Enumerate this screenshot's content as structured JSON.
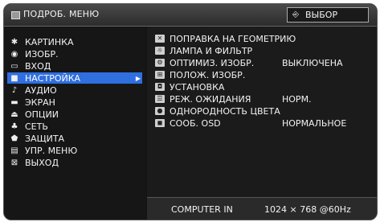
{
  "header": {
    "title": "ПОДРОБ. МЕНЮ",
    "select_label": "ВЫБОР",
    "select_icon": "ENTER-select-icon"
  },
  "menu": {
    "items": [
      {
        "label": "КАРТИНКА",
        "icon": "sun-icon"
      },
      {
        "label": "ИЗОБР.",
        "icon": "image-icon"
      },
      {
        "label": "ВХОД",
        "icon": "input-icon"
      },
      {
        "label": "НАСТРОЙКА",
        "icon": "setup-icon",
        "active": true
      },
      {
        "label": "АУДИО",
        "icon": "note-icon"
      },
      {
        "label": "ЭКРАН",
        "icon": "screen-icon"
      },
      {
        "label": "ОПЦИИ",
        "icon": "options-icon"
      },
      {
        "label": "СЕТЬ",
        "icon": "network-icon"
      },
      {
        "label": "ЗАЩИТА",
        "icon": "shield-icon"
      },
      {
        "label": "УПР. МЕНЮ",
        "icon": "menu-icon"
      },
      {
        "label": "ВЫХОД",
        "icon": "exit-icon"
      }
    ]
  },
  "submenu": {
    "items": [
      {
        "label": "ПОПРАВКА НА ГЕОМЕТРИЮ",
        "value": ""
      },
      {
        "label": "ЛАМПА И ФИЛЬТР",
        "value": ""
      },
      {
        "label": "ОПТИМИЗ. ИЗОБР.",
        "value": "ВЫКЛЮЧЕНА"
      },
      {
        "label": "ПОЛОЖ. ИЗОБР.",
        "value": ""
      },
      {
        "label": "УСТАНОВКА",
        "value": ""
      },
      {
        "label": "РЕЖ. ОЖИДАНИЯ",
        "value": "НОРМ."
      },
      {
        "label": "ОДНОРОДНОСТЬ ЦВЕТА",
        "value": ""
      },
      {
        "label": "СООБ. OSD",
        "value": "НОРМАЛЬНОЕ"
      }
    ]
  },
  "status": {
    "input": "COMPUTER IN",
    "signal": "1024 × 768 @60Hz"
  },
  "colors": {
    "highlight": "#2f6fe0",
    "background": "#141414"
  }
}
